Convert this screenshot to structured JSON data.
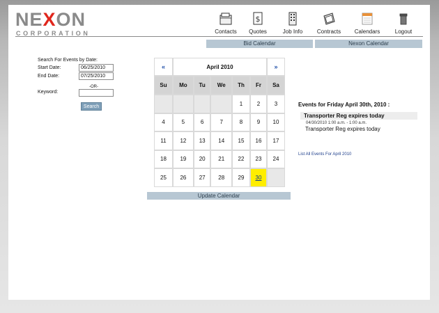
{
  "logo": {
    "word_prefix": "NE",
    "word_x": "X",
    "word_suffix": "ON",
    "subtitle": "CORPORATION"
  },
  "nav": [
    {
      "label": "Contacts",
      "icon": "folder-icon"
    },
    {
      "label": "Quotes",
      "icon": "dollar-document-icon"
    },
    {
      "label": "Job Info",
      "icon": "building-icon"
    },
    {
      "label": "Contracts",
      "icon": "folder-stack-icon"
    },
    {
      "label": "Calendars",
      "icon": "calendar-icon"
    },
    {
      "label": "Logout",
      "icon": "trash-can-icon"
    }
  ],
  "tabs": {
    "bid_calendar": "Bid Calendar",
    "nexon_calendar": "Nexon Calendar"
  },
  "search": {
    "heading": "Search For Events by Date:",
    "start_label": "Start Date:",
    "start_value": "06/25/2010",
    "end_label": "End Date:",
    "end_value": "07/25/2010",
    "or_text": "-OR-",
    "keyword_label": "Keyword:",
    "keyword_value": "",
    "button": "Search"
  },
  "calendar": {
    "prev": "«",
    "next": "»",
    "month": "April 2010",
    "weekdays": [
      "Su",
      "Mo",
      "Tu",
      "We",
      "Th",
      "Fr",
      "Sa"
    ],
    "weeks": [
      [
        "",
        "",
        "",
        "",
        "1",
        "2",
        "3"
      ],
      [
        "4",
        "5",
        "6",
        "7",
        "8",
        "9",
        "10"
      ],
      [
        "11",
        "12",
        "13",
        "14",
        "15",
        "16",
        "17"
      ],
      [
        "18",
        "19",
        "20",
        "21",
        "22",
        "23",
        "24"
      ],
      [
        "25",
        "26",
        "27",
        "28",
        "29",
        "30",
        ""
      ]
    ],
    "selected_day": "30",
    "update_label": "Update Calendar"
  },
  "events": {
    "title": "Events for Friday April 30th, 2010 :",
    "items": [
      {
        "header": "Transporter Reg expires today",
        "time": "04/30/2010 1:00 a.m. - 1:00 a.m.",
        "description": "Transporter Reg expires today"
      }
    ],
    "list_all": "List All Events For April 2010"
  },
  "colors": {
    "accent_red": "#e0261c",
    "tab_bg": "#b7c7d3",
    "today_bg": "#ffee00",
    "button_bg": "#7e9fb8"
  }
}
